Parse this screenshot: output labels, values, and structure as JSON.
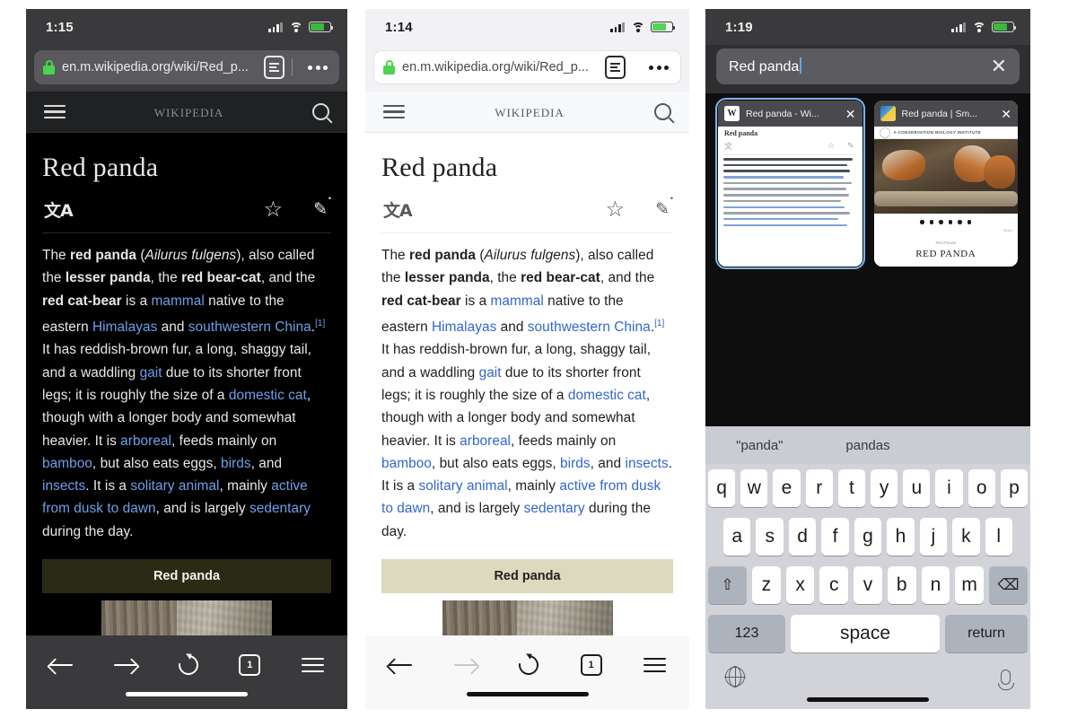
{
  "panels": {
    "dark_browser": {
      "status": {
        "time": "1:15"
      },
      "url": "en.m.wikipedia.org/wiki/Red_p...",
      "wikipedia_wordmark": "Wikipedia",
      "article": {
        "title": "Red panda",
        "language_icon": "文A",
        "star_icon": "☆",
        "pencil_icon": "✎",
        "lock_badge": "🔒",
        "lead_html": "The <b>red panda</b> (<i>Ailurus fulgens</i>), also called the <b>lesser panda</b>, the <b>red bear-cat</b>, and the <b>red cat-bear</b> is a <a>mammal</a> native to the eastern <a>Himalayas</a> and <a>southwestern China</a>.<sup>[1]</sup> It has reddish-brown fur, a long, shaggy tail, and a waddling <a>gait</a> due to its shorter front legs; it is roughly the size of a <a>domestic cat</a>, though with a longer body and somewhat heavier. It is <a>arboreal</a>, feeds mainly on <a>bamboo</a>, but also eats eggs, <a>birds</a>, and <a>insects</a>. It is a <a>solitary animal</a>, mainly <a>active from dusk to dawn</a>, and is largely <a>sedentary</a> during the day.",
        "infobox_header": "Red panda"
      },
      "toolbar": {
        "tab_count": "1"
      }
    },
    "light_browser": {
      "status": {
        "time": "1:14"
      },
      "url": "en.m.wikipedia.org/wiki/Red_p...",
      "wikipedia_wordmark": "Wikipedia",
      "article": {
        "title": "Red panda",
        "language_icon": "文A",
        "star_icon": "☆",
        "pencil_icon": "✎",
        "lock_badge": "🔒",
        "infobox_header": "Red panda"
      },
      "toolbar": {
        "tab_count": "1"
      }
    },
    "tab_switcher": {
      "status": {
        "time": "1:19"
      },
      "search": {
        "value": "Red panda",
        "clear_icon": "✕"
      },
      "tabs": [
        {
          "title": "Red panda - Wi...",
          "favicon": "W",
          "close_icon": "✕",
          "mini_title": "Red panda"
        },
        {
          "title": "Red panda | Sm...",
          "favicon": "",
          "close_icon": "✕",
          "site_header": "A CONSERVATION BIOLOGY INSTITUTE",
          "caption": "Red Panda",
          "heading": "RED PANDA"
        }
      ],
      "keyboard": {
        "suggestions": [
          "\"panda\"",
          "pandas"
        ],
        "row1": [
          "q",
          "w",
          "e",
          "r",
          "t",
          "y",
          "u",
          "i",
          "o",
          "p"
        ],
        "row2": [
          "a",
          "s",
          "d",
          "f",
          "g",
          "h",
          "j",
          "k",
          "l"
        ],
        "row3": [
          "z",
          "x",
          "c",
          "v",
          "b",
          "n",
          "m"
        ],
        "shift_icon": "⇧",
        "backspace_icon": "⌫",
        "numeric_key": "123",
        "space_key": "space",
        "return_key": "return",
        "globe_icon": "globe",
        "mic_icon": "microphone"
      }
    }
  },
  "colors": {
    "accent": "#7ab4ef",
    "link_dark": "#6f9fe8",
    "link_light": "#3366cc",
    "battery": "#3ad13a"
  }
}
